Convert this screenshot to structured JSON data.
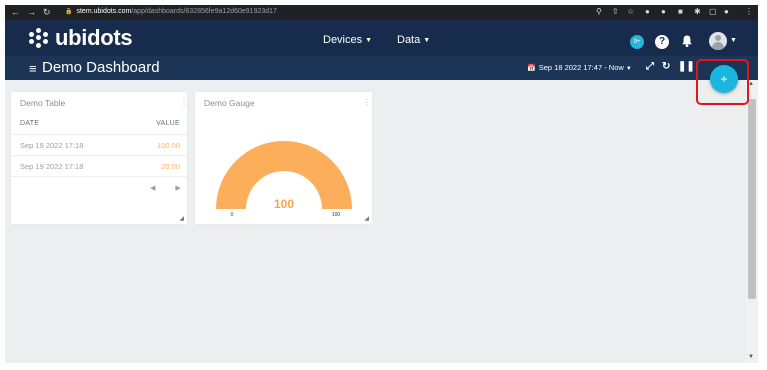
{
  "browser": {
    "url_host": "stem.ubidots.com",
    "url_path": "/app/dashboards/632856fe9a12d60e91923d17"
  },
  "header": {
    "logo_text": "ubidots",
    "menu": [
      {
        "label": "Devices"
      },
      {
        "label": "Data"
      }
    ],
    "notification_badge": "9+",
    "help_icon": "?"
  },
  "dashboard": {
    "title": "Demo Dashboard",
    "date_range": "Sep 18 2022 17:47 - Now"
  },
  "widgets": {
    "table": {
      "title": "Demo Table",
      "columns": [
        "DATE",
        "VALUE"
      ],
      "rows": [
        {
          "date": "Sep 19 2022 17:18",
          "value": "100.00"
        },
        {
          "date": "Sep 19 2022 17:18",
          "value": "20.00"
        }
      ]
    },
    "gauge": {
      "title": "Demo Gauge",
      "value": "100",
      "min": "0",
      "max": "100",
      "fill_fraction": 1.0
    }
  },
  "colors": {
    "topbar": "#172c4d",
    "accent": "#1bb6df",
    "gauge": "#fcae5a",
    "highlight": "#e0181c"
  }
}
